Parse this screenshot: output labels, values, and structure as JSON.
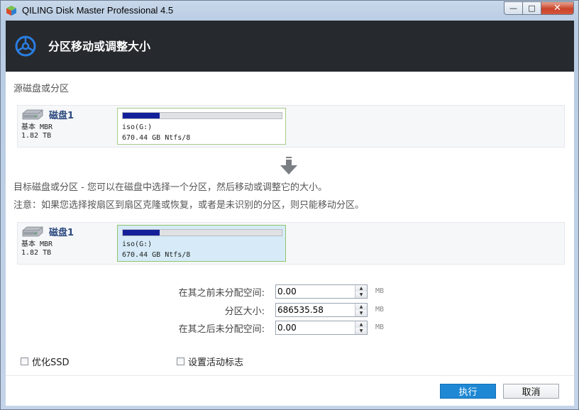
{
  "window": {
    "title": "QILING Disk Master Professional 4.5",
    "controls": {
      "minimize": "—",
      "maximize": "□",
      "close": "✕"
    }
  },
  "header": {
    "title": "分区移动或调整大小",
    "accent": "#2a7de1"
  },
  "source": {
    "section_label": "源磁盘或分区",
    "disk": {
      "name": "磁盘1",
      "type": "基本 MBR",
      "size": "1.82 TB",
      "partition": {
        "label": "iso(G:)",
        "details": "670.44 GB Ntfs/8",
        "used_fraction": 0.23,
        "selected": false
      }
    }
  },
  "target": {
    "section_label": "目标磁盘或分区 - 您可以在磁盘中选择一个分区，然后移动或调整它的大小。",
    "note": "注意：如果您选择按扇区到扇区克隆或恢复，或者是未识别的分区，则只能移动分区。",
    "disk": {
      "name": "磁盘1",
      "type": "基本 MBR",
      "size": "1.82 TB",
      "partition": {
        "label": "iso(G:)",
        "details": "670.44 GB Ntfs/8",
        "used_fraction": 0.23,
        "selected": true
      }
    }
  },
  "fields": [
    {
      "label": "在其之前未分配空间:",
      "value": "0.00",
      "unit": "MB"
    },
    {
      "label": "分区大小:",
      "value": "686535.58",
      "unit": "MB"
    },
    {
      "label": "在其之后未分配空间:",
      "value": "0.00",
      "unit": "MB"
    }
  ],
  "options": {
    "optimize_ssd": {
      "label": "优化SSD",
      "checked": false
    },
    "set_active": {
      "label": "设置活动标志",
      "checked": false
    }
  },
  "buttons": {
    "execute": "执行",
    "cancel": "取消"
  },
  "colors": {
    "usage_fill": "#14209a",
    "primary_button": "#1e88d4",
    "header_bg": "#26292d"
  }
}
